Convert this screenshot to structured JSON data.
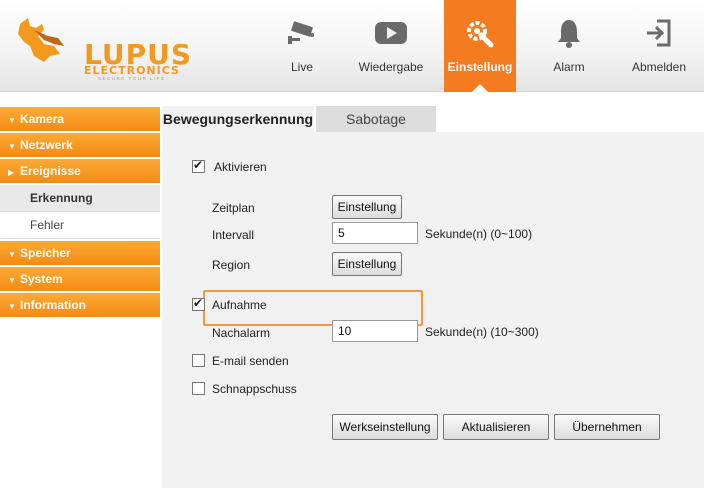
{
  "brand": {
    "name": "LUPUS",
    "sub": "ELECTRONICS",
    "tagline": "SECURE YOUR LIFE",
    "color": "#f39a1e"
  },
  "topnav": [
    {
      "label": "Live",
      "icon": "camera-icon"
    },
    {
      "label": "Wiedergabe",
      "icon": "play-icon"
    },
    {
      "label": "Einstellung",
      "icon": "settings-icon",
      "active": true
    },
    {
      "label": "Alarm",
      "icon": "bell-icon"
    },
    {
      "label": "Abmelden",
      "icon": "logout-icon"
    }
  ],
  "sidebar": {
    "items": [
      {
        "label": "Kamera"
      },
      {
        "label": "Netzwerk"
      },
      {
        "label": "Ereignisse",
        "expanded": true
      },
      {
        "label": "Erkennung",
        "sub": true,
        "active": true
      },
      {
        "label": "Fehler",
        "sub": true
      },
      {
        "label": "Speicher"
      },
      {
        "label": "System"
      },
      {
        "label": "Information"
      }
    ]
  },
  "tabs": [
    {
      "label": "Bewegungserkennung",
      "active": true
    },
    {
      "label": "Sabotage"
    }
  ],
  "form": {
    "aktivieren": {
      "label": "Aktivieren",
      "checked": true
    },
    "zeitplan": {
      "label": "Zeitplan",
      "button": "Einstellung"
    },
    "intervall": {
      "label": "Intervall",
      "value": "5",
      "unit": "Sekunde(n) (0~100)"
    },
    "region": {
      "label": "Region",
      "button": "Einstellung"
    },
    "aufnahme": {
      "label": "Aufnahme",
      "checked": true
    },
    "nachalarm": {
      "label": "Nachalarm",
      "value": "10",
      "unit": "Sekunde(n) (10~300)"
    },
    "email": {
      "label": "E-mail senden",
      "checked": false
    },
    "snapshot": {
      "label": "Schnappschuss",
      "checked": false
    }
  },
  "actions": {
    "default": "Werkseinstellung",
    "refresh": "Aktualisieren",
    "apply": "Übernehmen"
  },
  "colors": {
    "accent": "#f47b20",
    "highlight": "#f39a3a"
  }
}
